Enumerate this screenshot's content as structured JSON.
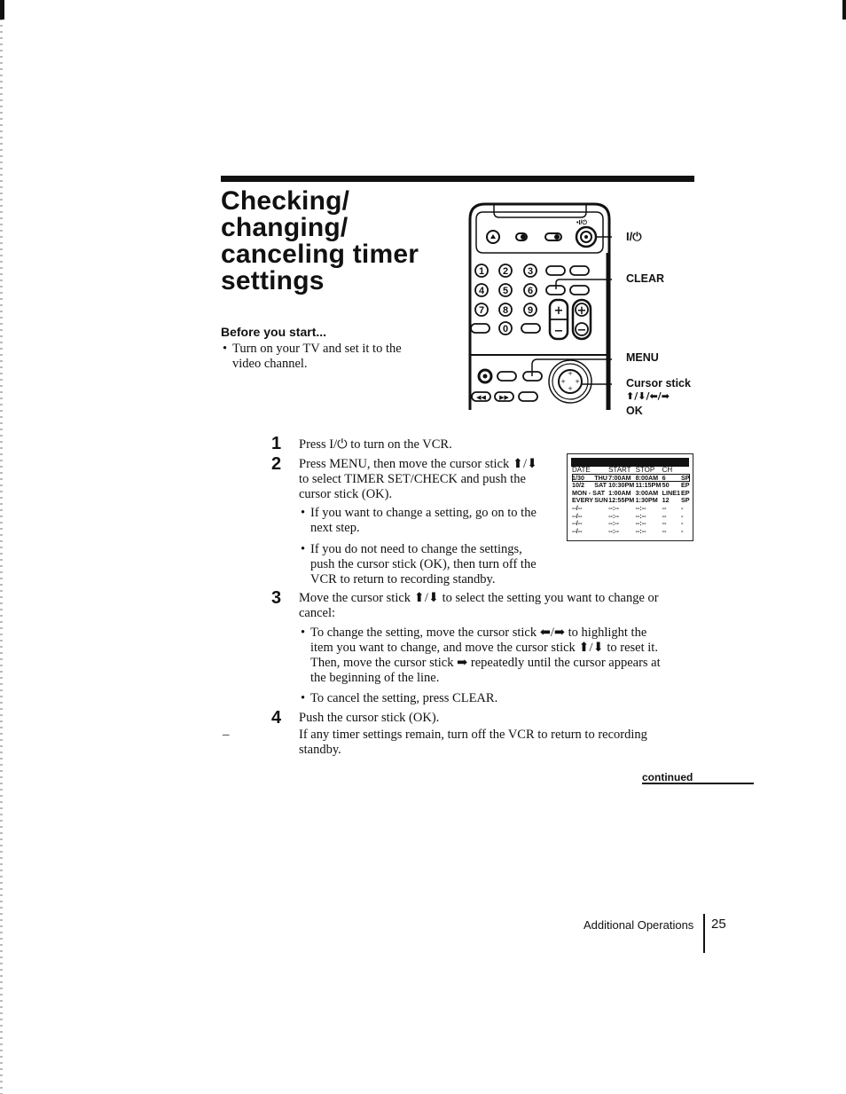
{
  "page": {
    "title_lines": [
      "Checking/",
      "changing/",
      "canceling timer",
      "settings"
    ],
    "before_you_start": {
      "heading": "Before you start...",
      "items": [
        {
          "bullet": "•",
          "line1": "Turn on your TV and set it to the",
          "line2": "video channel."
        }
      ]
    },
    "remote_callouts": {
      "power": "I/⏻",
      "clear": "CLEAR",
      "menu": "MENU",
      "cursor_stick": "Cursor stick",
      "arrows": "⬆/⬇/⬅/➡",
      "ok": "OK",
      "power_small_label": "•I/⏻"
    },
    "remote_keys": {
      "digits": [
        "1",
        "2",
        "3",
        "4",
        "5",
        "6",
        "7",
        "8",
        "9",
        "0"
      ],
      "plus": "+",
      "minus": "−"
    },
    "steps": [
      {
        "num": "1",
        "lines": [
          "Press I/⏻ to turn on the VCR."
        ]
      },
      {
        "num": "2",
        "lines": [
          "Press MENU, then move the cursor stick ⬆/⬇",
          "to select TIMER SET/CHECK and push the",
          "cursor stick (OK)."
        ],
        "bullets": [
          {
            "line1": "If you want to change a setting, go on to the",
            "line2": "next step."
          },
          {
            "line1": "If you do not need to change the settings,",
            "line2": "push the cursor stick (OK), then turn off the",
            "line3": "VCR to return to recording standby."
          }
        ]
      },
      {
        "num": "3",
        "lines": [
          "Move the cursor stick ⬆/⬇ to select the setting you want to change or",
          "cancel:"
        ],
        "bullets": [
          {
            "line1": "To change the setting, move the cursor stick ⬅/➡ to highlight the",
            "line2": "item you want to change, and move the cursor stick ⬆/⬇ to reset it.",
            "line3": "Then, move the cursor stick ➡ repeatedly until the cursor appears at",
            "line4": "the beginning of the line."
          },
          {
            "line1": "To cancel the setting, press CLEAR."
          }
        ]
      },
      {
        "num": "4",
        "lines": [
          "Push the cursor stick (OK)."
        ],
        "note": [
          "If any timer settings remain, turn off the VCR to return to recording",
          "standby."
        ]
      }
    ],
    "osd": {
      "headers": [
        "DATE",
        "START",
        "STOP",
        "CH"
      ],
      "rows": [
        {
          "date": "1/30",
          "day": "THU",
          "start": "7:00AM",
          "stop": "8:00AM",
          "ch": "6",
          "speed": "SP",
          "selected": true
        },
        {
          "date": "10/2",
          "day": "SAT",
          "start": "10:30PM",
          "stop": "11:15PM",
          "ch": "50",
          "speed": "EP"
        },
        {
          "date": "MON - SAT",
          "day": "",
          "start": "1:00AM",
          "stop": "3:00AM",
          "ch": "LINE1",
          "speed": "EP"
        },
        {
          "date": "EVERY",
          "day": "SUN",
          "start": "12:55PM",
          "stop": "1:30PM",
          "ch": "12",
          "speed": "SP"
        },
        {
          "date": "--/--",
          "day": "",
          "start": "--:--",
          "stop": "--:--",
          "ch": "--",
          "speed": "-"
        },
        {
          "date": "--/--",
          "day": "",
          "start": "--:--",
          "stop": "--:--",
          "ch": "--",
          "speed": "-"
        },
        {
          "date": "--/--",
          "day": "",
          "start": "--:--",
          "stop": "--:--",
          "ch": "--",
          "speed": "-"
        },
        {
          "date": "--/--",
          "day": "",
          "start": "--:--",
          "stop": "--:--",
          "ch": "--",
          "speed": "-"
        }
      ]
    },
    "continued": "continued",
    "footer": {
      "section": "Additional Operations",
      "page_number": "25"
    },
    "margin_dash": "–"
  }
}
